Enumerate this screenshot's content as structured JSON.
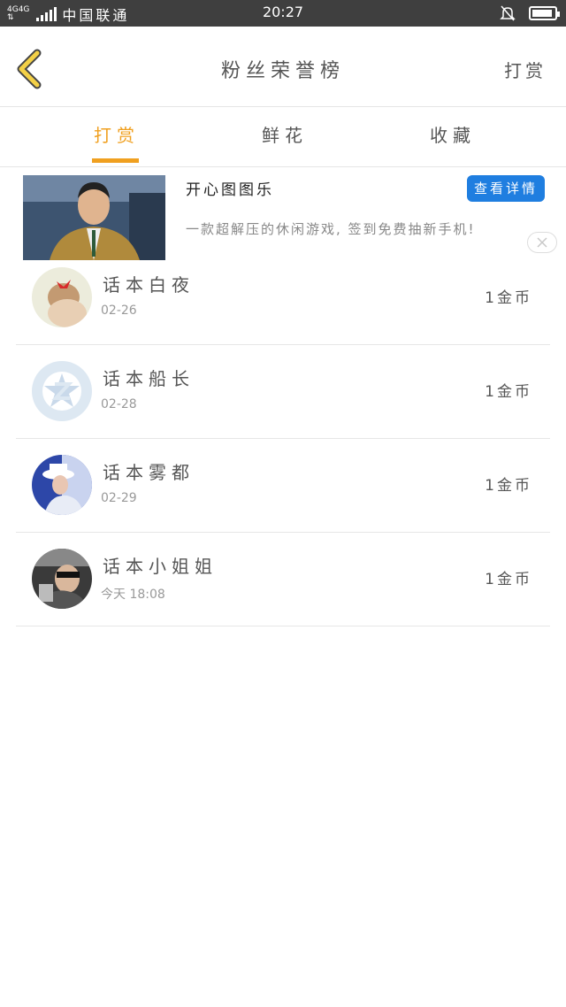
{
  "status_bar": {
    "network_top": "4G4G",
    "network_bottom": "⇅",
    "carrier": "中国联通",
    "time": "20:27",
    "battery_level": 0.9
  },
  "nav": {
    "title": "粉丝荣誉榜",
    "action": "打赏"
  },
  "tabs": [
    {
      "label": "打赏",
      "active": true
    },
    {
      "label": "鲜花",
      "active": false
    },
    {
      "label": "收藏",
      "active": false
    }
  ],
  "ad": {
    "name": "开心图图乐",
    "description": "一款超解压的休闲游戏, 签到免费抽新手机!",
    "button_label": "查看详情"
  },
  "fans": [
    {
      "name": "话本白夜",
      "date": "02-26",
      "reward": "1金币"
    },
    {
      "name": "话本船长",
      "date": "02-28",
      "reward": "1金币"
    },
    {
      "name": "话本雾都",
      "date": "02-29",
      "reward": "1金币"
    },
    {
      "name": "话本小姐姐",
      "date": "今天 18:08",
      "reward": "1金币"
    }
  ],
  "colors": {
    "accent": "#f0a020",
    "status_bar": "#3f3f3f",
    "ad_button": "#1f7ee0"
  }
}
